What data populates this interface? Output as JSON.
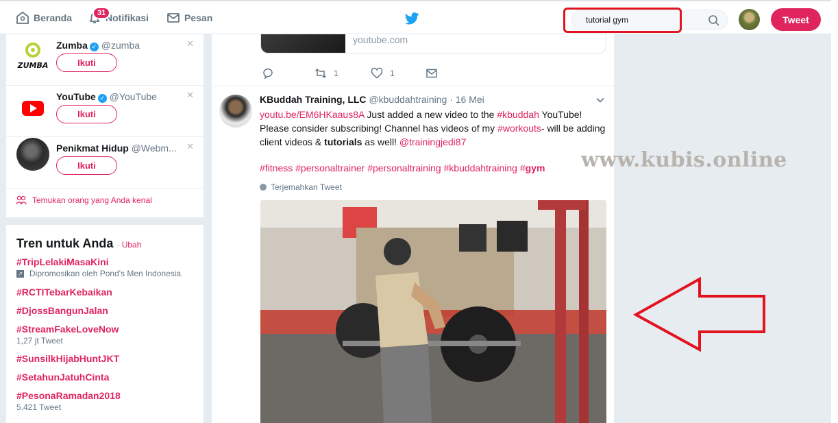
{
  "nav": {
    "home": "Beranda",
    "notifications": "Notifikasi",
    "notifications_count": "31",
    "messages": "Pesan",
    "tweet_button": "Tweet"
  },
  "search": {
    "value": "tutorial gym"
  },
  "who_to_follow": {
    "accounts": [
      {
        "name": "Zumba",
        "handle": "@zumba",
        "verified": true,
        "follow_label": "Ikuti"
      },
      {
        "name": "YouTube",
        "handle": "@YouTube",
        "verified": true,
        "follow_label": "Ikuti"
      },
      {
        "name": "Penikmat Hidup",
        "handle": "@Webm...",
        "verified": false,
        "follow_label": "Ikuti"
      }
    ],
    "find_people": "Temukan orang yang Anda kenal"
  },
  "trends": {
    "title": "Tren untuk Anda",
    "separator": "·",
    "change": "Ubah",
    "items": [
      {
        "name": "#TripLelakiMasaKini",
        "meta": "Dipromosikan oleh Pond's Men Indonesia"
      },
      {
        "name": "#RCTITebarKebaikan",
        "meta": ""
      },
      {
        "name": "#DjossBangunJalan",
        "meta": ""
      },
      {
        "name": "#StreamFakeLoveNow",
        "meta": "1,27 jt Tweet"
      },
      {
        "name": "#SunsilkHijabHuntJKT",
        "meta": ""
      },
      {
        "name": "#SetahunJatuhCinta",
        "meta": ""
      },
      {
        "name": "#PesonaRamadan2018",
        "meta": "5.421 Tweet"
      }
    ]
  },
  "previous_tweet": {
    "card_domain": "youtube.com",
    "retweets": "1",
    "likes": "1"
  },
  "tweet": {
    "name": "KBuddah Training, LLC",
    "handle": "@kbuddahtraining",
    "separator": "·",
    "date": "16 Mei",
    "link": "youtu.be/EM6HKaaus8A",
    "text_1": " Just added a new video to the ",
    "hashtag_1": "#kbuddah",
    "text_2": " YouTube! Please consider subscribing! Channel has videos of my ",
    "hashtag_2": "#workouts",
    "text_3": "- will be adding client videos & ",
    "bold_word": "tutorials",
    "text_4": " as well! ",
    "mention": "@trainingjedi87",
    "tags": [
      "#fitness",
      "#personaltrainer",
      "#personaltraining",
      "#kbuddahtraining"
    ],
    "tag_gym_prefix": "#",
    "tag_gym_word": "gym",
    "translate": "Terjemahkan Tweet"
  },
  "watermark": "www.kubis.online",
  "colors": {
    "accent": "#e0245e",
    "annotation_red": "#e3121f",
    "background": "#e6ecf0",
    "verified": "#1da1f2"
  }
}
